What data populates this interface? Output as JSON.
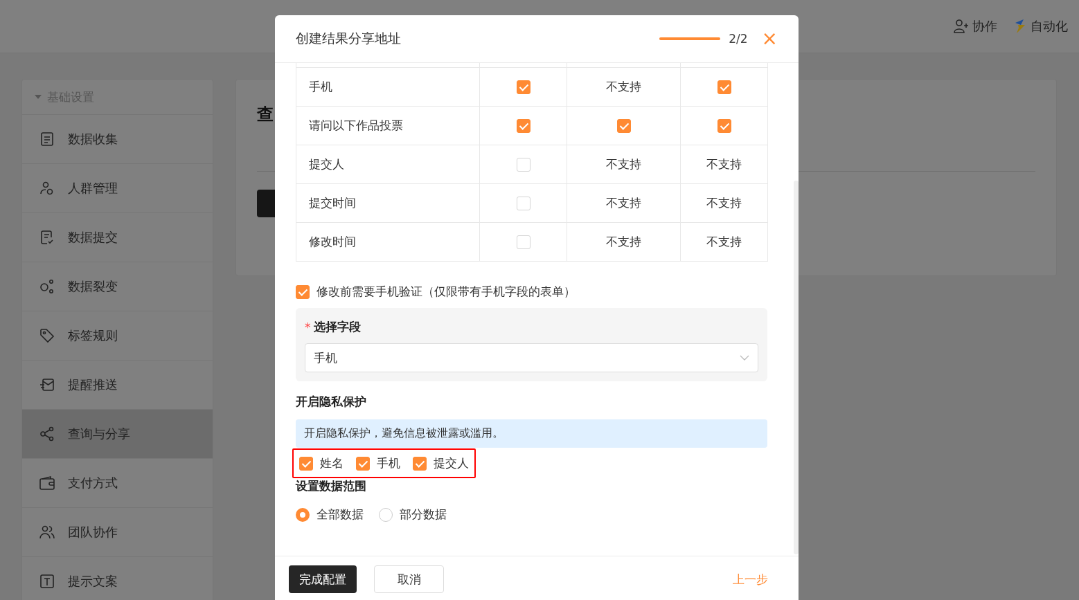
{
  "top_bar": {
    "actions": [
      {
        "label": "协作"
      },
      {
        "label": "自动化"
      }
    ]
  },
  "sidebar": {
    "group": {
      "label": "基础设置",
      "expanded": true
    },
    "items": [
      {
        "label": "数据收集",
        "selected": false
      },
      {
        "label": "人群管理",
        "selected": false
      },
      {
        "label": "数据提交",
        "selected": false
      },
      {
        "label": "数据裂变",
        "selected": false
      },
      {
        "label": "标签规则",
        "selected": false
      },
      {
        "label": "提醒推送",
        "selected": false
      },
      {
        "label": "查询与分享",
        "selected": true
      },
      {
        "label": "支付方式",
        "selected": false
      },
      {
        "label": "团队协作",
        "selected": false
      },
      {
        "label": "提示文案",
        "selected": false
      }
    ]
  },
  "main": {
    "title": "查"
  },
  "dialog": {
    "title": "创建结果分享地址",
    "progress": {
      "level": 1
    },
    "step": "2/2",
    "close": "×",
    "table": {
      "rows": [
        {
          "name": "手机",
          "cells": [
            {
              "kind": "checkbox",
              "checked": true
            },
            {
              "kind": "text",
              "text": "不支持"
            },
            {
              "kind": "checkbox",
              "checked": true
            }
          ]
        },
        {
          "name": "请问以下作品投票",
          "cells": [
            {
              "kind": "checkbox",
              "checked": true
            },
            {
              "kind": "checkbox",
              "checked": true
            },
            {
              "kind": "checkbox",
              "checked": true
            }
          ]
        },
        {
          "name": "提交人",
          "cells": [
            {
              "kind": "checkbox",
              "checked": false
            },
            {
              "kind": "text",
              "text": "不支持"
            },
            {
              "kind": "text",
              "text": "不支持"
            }
          ]
        },
        {
          "name": "提交时间",
          "cells": [
            {
              "kind": "checkbox",
              "checked": false
            },
            {
              "kind": "text",
              "text": "不支持"
            },
            {
              "kind": "text",
              "text": "不支持"
            }
          ]
        },
        {
          "name": "修改时间",
          "cells": [
            {
              "kind": "checkbox",
              "checked": false
            },
            {
              "kind": "text",
              "text": "不支持"
            },
            {
              "kind": "text",
              "text": "不支持"
            }
          ]
        }
      ]
    },
    "verify": {
      "label": "修改前需要手机验证（仅限带有手机字段的表单）",
      "checked": true
    },
    "field_select": {
      "required_mark": "*",
      "label": "选择字段",
      "value": "手机"
    },
    "privacy": {
      "heading": "开启隐私保护",
      "notice": "开启隐私保护，避免信息被泄露或滥用。",
      "options": [
        {
          "label": "姓名",
          "checked": true
        },
        {
          "label": "手机",
          "checked": true
        },
        {
          "label": "提交人",
          "checked": true
        }
      ]
    },
    "scope": {
      "heading": "设置数据范围",
      "options": [
        {
          "label": "全部数据",
          "selected": true
        },
        {
          "label": "部分数据",
          "selected": false
        }
      ]
    },
    "footer": {
      "confirm": "完成配置",
      "cancel": "取消",
      "back": "上一步"
    }
  }
}
